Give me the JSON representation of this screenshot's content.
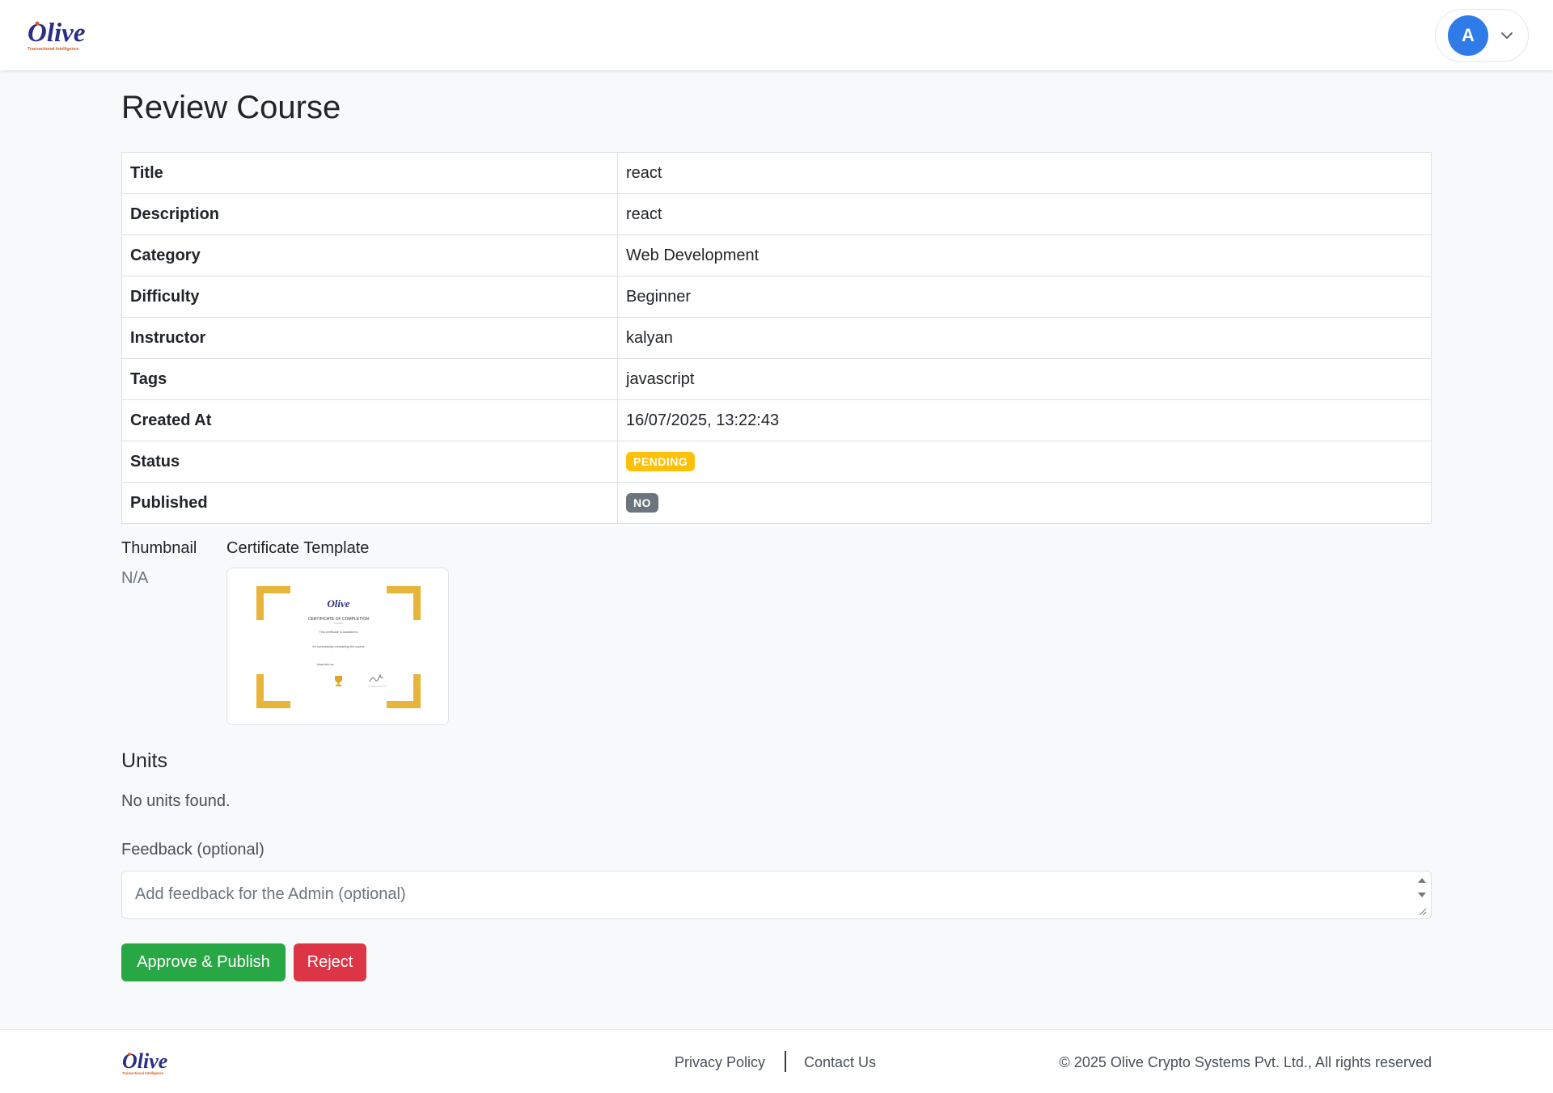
{
  "brand": {
    "name": "Olive",
    "tagline": "Transactional Intelligence"
  },
  "header": {
    "avatar_initial": "A"
  },
  "page": {
    "title": "Review Course"
  },
  "details": [
    {
      "label": "Title",
      "value": "react"
    },
    {
      "label": "Description",
      "value": "react"
    },
    {
      "label": "Category",
      "value": "Web Development"
    },
    {
      "label": "Difficulty",
      "value": "Beginner"
    },
    {
      "label": "Instructor",
      "value": "kalyan"
    },
    {
      "label": "Tags",
      "value": "javascript"
    },
    {
      "label": "Created At",
      "value": "16/07/2025, 13:22:43"
    },
    {
      "label": "Status",
      "value": "PENDING"
    },
    {
      "label": "Published",
      "value": "NO"
    }
  ],
  "media": {
    "thumbnail_label": "Thumbnail",
    "thumbnail_value": "N/A",
    "certificate_label": "Certificate Template",
    "certificate": {
      "heading": "CERTIFICATE OF COMPLETION",
      "line1": "This certificate is awarded to",
      "line2": "for successfully completing the course",
      "line3": "Awarded on:"
    }
  },
  "units": {
    "title": "Units",
    "empty_text": "No units found."
  },
  "feedback": {
    "label": "Feedback (optional)",
    "placeholder": "Add feedback for the Admin (optional)",
    "value": ""
  },
  "actions": {
    "approve_label": "Approve & Publish",
    "reject_label": "Reject"
  },
  "footer": {
    "privacy": "Privacy Policy",
    "contact": "Contact Us",
    "copyright": "© 2025 Olive Crypto Systems Pvt. Ltd., All rights reserved"
  },
  "colors": {
    "approve": "#28a745",
    "reject": "#dc3545",
    "pending": "#ffc107",
    "no": "#6c757d",
    "avatar": "#2f7be8",
    "brand_navy": "#2a2e86",
    "brand_orange": "#d2601e"
  }
}
